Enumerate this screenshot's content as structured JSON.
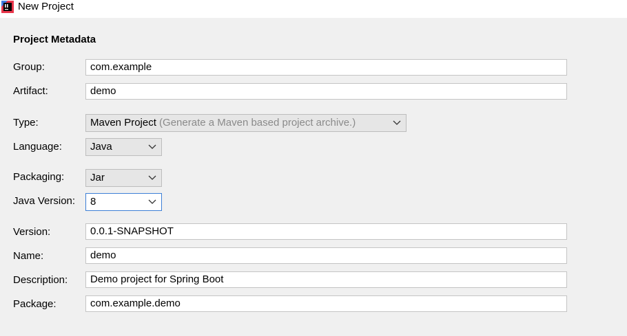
{
  "window": {
    "title": "New Project",
    "icon": "intellij-app-icon"
  },
  "section": {
    "title": "Project Metadata"
  },
  "fields": {
    "group": {
      "label": "Group:",
      "value": "com.example"
    },
    "artifact": {
      "label": "Artifact:",
      "value": "demo"
    },
    "type": {
      "label": "Type:",
      "value": "Maven Project",
      "hint": "(Generate a Maven based project archive.)"
    },
    "language": {
      "label": "Language:",
      "value": "Java"
    },
    "packaging": {
      "label": "Packaging:",
      "value": "Jar"
    },
    "java_version": {
      "label": "Java Version:",
      "value": "8"
    },
    "version": {
      "label": "Version:",
      "value": "0.0.1-SNAPSHOT"
    },
    "name": {
      "label": "Name:",
      "value": "demo"
    },
    "description": {
      "label": "Description:",
      "value": "Demo project for Spring Boot"
    },
    "package": {
      "label": "Package:",
      "value": "com.example.demo"
    }
  },
  "colors": {
    "background": "#f0f0f0",
    "field_border": "#c4c4c4",
    "focus_border": "#3c7fd6",
    "hint_text": "#8a8a8a"
  }
}
